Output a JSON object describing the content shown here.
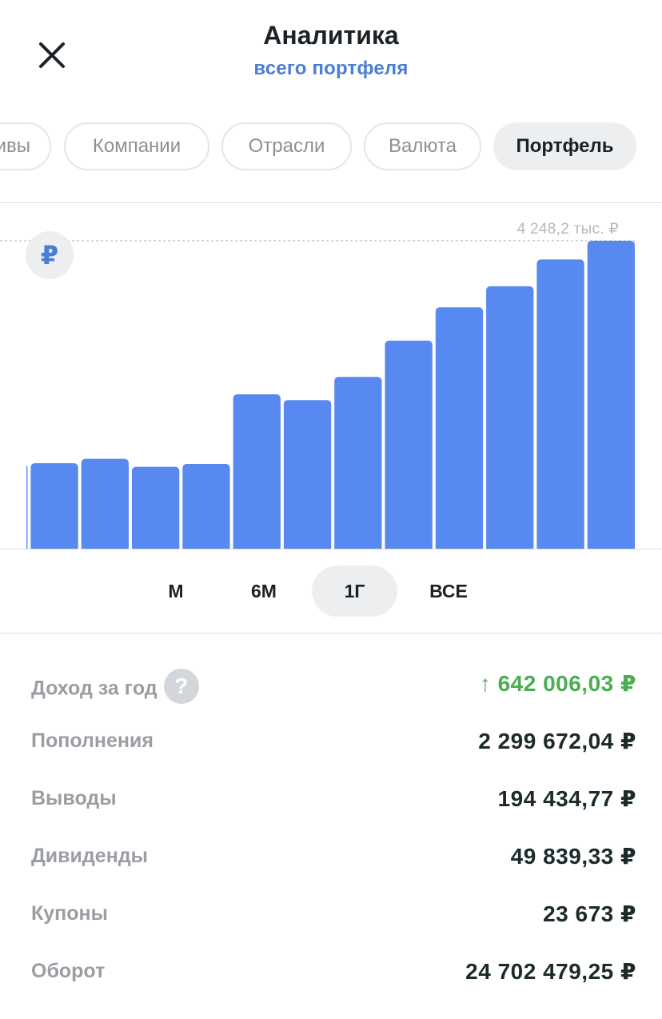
{
  "header": {
    "title": "Аналитика",
    "subtitle": "всего портфеля",
    "close_icon": "close-icon"
  },
  "chips": [
    {
      "label": "ивы",
      "active": false
    },
    {
      "label": "Компании",
      "active": false
    },
    {
      "label": "Отрасли",
      "active": false
    },
    {
      "label": "Валюта",
      "active": false
    },
    {
      "label": "Портфель",
      "active": true
    }
  ],
  "chart": {
    "max_label": "4 248,2 тыс. ₽",
    "currency_symbol": "₽",
    "bar_color": "#5789f0"
  },
  "chart_data": {
    "type": "bar",
    "categories": [
      "",
      "",
      "",
      "",
      "",
      "",
      "",
      "",
      "",
      "",
      "",
      "",
      ""
    ],
    "values": [
      1150,
      1180,
      1240,
      1130,
      1170,
      2130,
      2050,
      2370,
      2870,
      3330,
      3620,
      3990,
      4248.2
    ],
    "ylim": [
      0,
      4248.2
    ],
    "max_value_label": "4 248,2 тыс. ₽",
    "grid": false
  },
  "periods": [
    {
      "label": "М",
      "active": false
    },
    {
      "label": "6М",
      "active": false
    },
    {
      "label": "1Г",
      "active": true
    },
    {
      "label": "ВСЕ",
      "active": false
    }
  ],
  "stats": {
    "income": {
      "label": "Доход за год",
      "value": "642 006,03 ₽",
      "arrow": "↑",
      "color": "#4aad52"
    },
    "deposits": {
      "label": "Пополнения",
      "value": "2 299 672,04 ₽"
    },
    "withdrawals": {
      "label": "Выводы",
      "value": "194 434,77 ₽"
    },
    "dividends": {
      "label": "Дивиденды",
      "value": "49 839,33 ₽"
    },
    "coupons": {
      "label": "Купоны",
      "value": "23 673 ₽"
    },
    "turnover": {
      "label": "Оборот",
      "value": "24 702 479,25 ₽"
    }
  }
}
